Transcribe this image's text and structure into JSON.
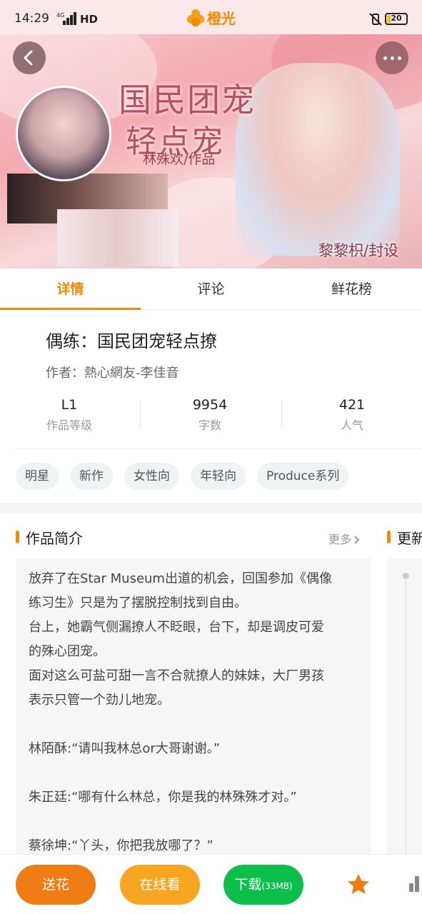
{
  "status_bar": {
    "time": "14:29",
    "network": "4G",
    "hd": "HD",
    "battery": "20",
    "battery_color": "#f2c400"
  },
  "app": {
    "name": "橙光",
    "logo_icon": "flower-logo-icon",
    "brand_color": "#f08a00"
  },
  "banner": {
    "title_line1": "国民团宠",
    "title_line2": "轻点宠",
    "author_line": "林殊欢/作品",
    "credit": "黎黎枳/封设"
  },
  "nav": {
    "back_icon": "chevron-left-icon",
    "more_icon": "more-dots-icon"
  },
  "tabs": [
    {
      "label": "详情",
      "active": true
    },
    {
      "label": "评论",
      "active": false
    },
    {
      "label": "鲜花榜",
      "active": false
    }
  ],
  "book": {
    "title": "偶练：国民团宠轻点撩",
    "author": "作者：熱心網友-李佳音"
  },
  "stats": [
    {
      "value": "L1",
      "label": "作品等级"
    },
    {
      "value": "9954",
      "label": "字数"
    },
    {
      "value": "421",
      "label": "人气"
    }
  ],
  "tags": [
    "明星",
    "新作",
    "女性向",
    "年轻向",
    "Produce系列"
  ],
  "intro": {
    "title": "作品简介",
    "more": "更多",
    "lines": [
      "放弃了在Star Museum出道的机会，回国参加《偶像",
      "练习生》只是为了摆脱控制找到自由。",
      "台上，她霸气侧漏撩人不眨眼，台下，却是调皮可爱",
      "的殊心团宠。",
      "面对这么可盐可甜一言不合就撩人的妹妹，大厂男孩",
      "表示只管一个劲儿地宠。",
      "",
      "林陌酥:“请叫我林总or大哥谢谢。”",
      "",
      "朱正廷:“哪有什么林总，你是我的林殊殊才对。”",
      "",
      "蔡徐坤:“丫头，你把我放哪了？”"
    ]
  },
  "update": {
    "title": "更新"
  },
  "bottom_bar": {
    "gift": "送花",
    "read": "在线看",
    "download": "下载",
    "download_size": "(33MB)",
    "favorite_icon": "star-icon",
    "chart_icon": "bar-chart-icon"
  }
}
